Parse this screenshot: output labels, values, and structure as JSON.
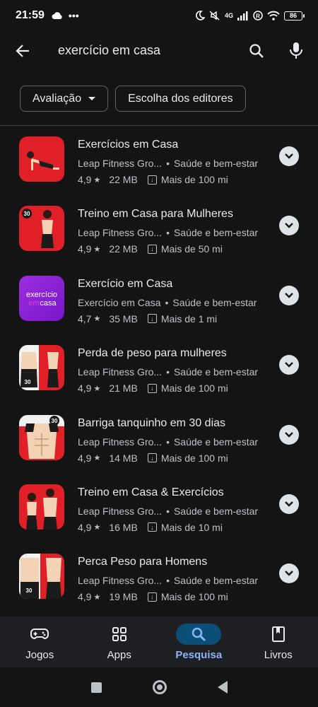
{
  "status": {
    "time": "21:59",
    "network": "4G",
    "battery": "86"
  },
  "search": {
    "query": "exercício em casa"
  },
  "filters": [
    {
      "label": "Avaliação",
      "has_dropdown": true
    },
    {
      "label": "Escolha dos editores",
      "has_dropdown": false
    }
  ],
  "results": [
    {
      "title": "Exercícios em Casa",
      "developer": "Leap Fitness Gro...",
      "category": "Saúde e bem-estar",
      "rating": "4,9",
      "size": "22 MB",
      "downloads": "Mais de 100 mi",
      "icon": "red-pushup-icon"
    },
    {
      "title": "Treino em Casa para Mulheres",
      "developer": "Leap Fitness Gro...",
      "category": "Saúde e bem-estar",
      "rating": "4,9",
      "size": "22 MB",
      "downloads": "Mais de 50 mi",
      "icon": "red-women-workout-icon",
      "badge": "30"
    },
    {
      "title": "Exercício em Casa",
      "developer": "Exercício em Casa",
      "category": "Saúde e bem-estar",
      "rating": "4,7",
      "size": "35 MB",
      "downloads": "Mais de 1 mi",
      "icon": "purple-text-logo-icon",
      "logo_text_1": "exercício",
      "logo_text_2": "em",
      "logo_text_3": "casa"
    },
    {
      "title": "Perda de peso para mulheres",
      "developer": "Leap Fitness Gro...",
      "category": "Saúde e bem-estar",
      "rating": "4,9",
      "size": "21 MB",
      "downloads": "Mais de 100 mi",
      "icon": "red-before-after-women-icon",
      "badge": "30"
    },
    {
      "title": "Barriga tanquinho em 30 dias",
      "developer": "Leap Fitness Gro...",
      "category": "Saúde e bem-estar",
      "rating": "4,9",
      "size": "14 MB",
      "downloads": "Mais de 100 mi",
      "icon": "red-abs-icon",
      "badge": "30"
    },
    {
      "title": "Treino em Casa & Exercícios",
      "developer": "Leap Fitness Gro...",
      "category": "Saúde e bem-estar",
      "rating": "4,9",
      "size": "16 MB",
      "downloads": "Mais de 10 mi",
      "icon": "red-couple-workout-icon"
    },
    {
      "title": "Perca Peso para Homens",
      "developer": "Leap Fitness Gro...",
      "category": "Saúde e bem-estar",
      "rating": "4,9",
      "size": "19 MB",
      "downloads": "Mais de 100 mi",
      "icon": "red-before-after-men-icon",
      "badge": "30"
    }
  ],
  "bottom_nav": [
    {
      "label": "Jogos",
      "icon": "gamepad-icon",
      "active": false
    },
    {
      "label": "Apps",
      "icon": "apps-grid-icon",
      "active": false
    },
    {
      "label": "Pesquisa",
      "icon": "search-icon",
      "active": true
    },
    {
      "label": "Livros",
      "icon": "book-icon",
      "active": false
    }
  ],
  "colors": {
    "background": "#141414",
    "accent": "#8ab4f8",
    "active_pill": "#0b4f77",
    "app_red": "#e01f26",
    "app_purple": "#8a1fd6"
  }
}
